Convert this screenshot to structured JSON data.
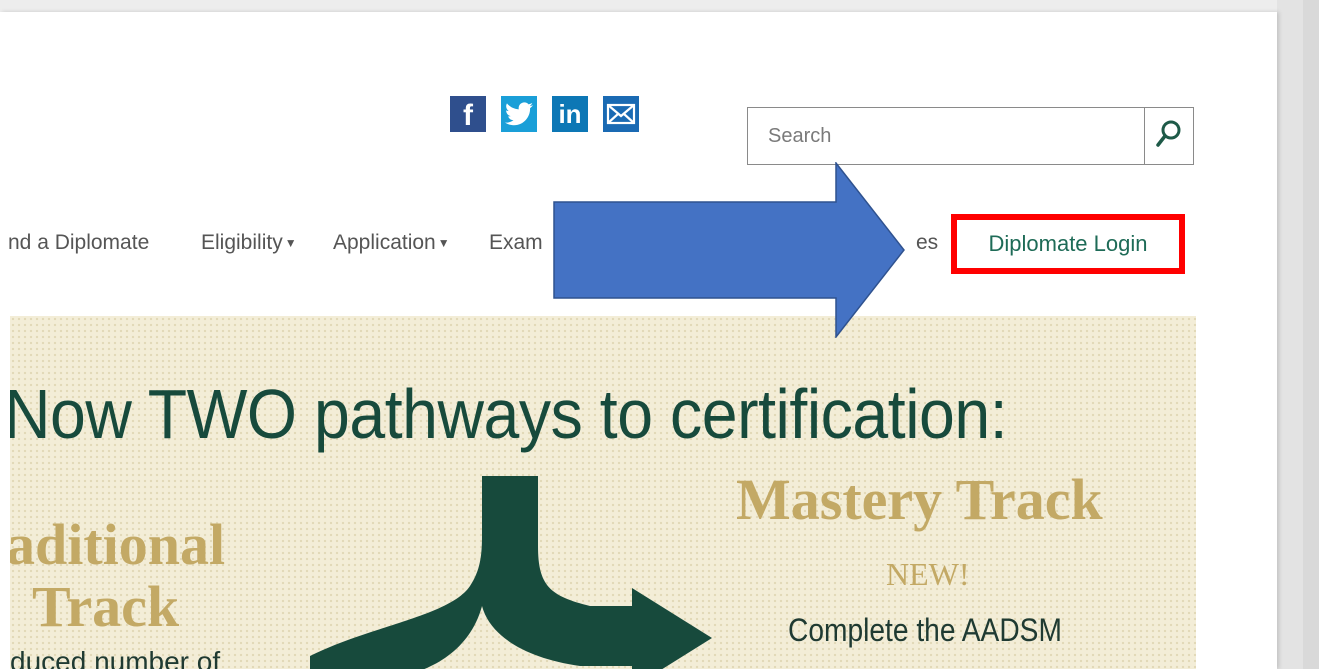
{
  "search": {
    "placeholder": "Search"
  },
  "social": {
    "facebook_glyph": "f",
    "linkedin_glyph": "in",
    "icons": [
      "facebook-icon",
      "twitter-icon",
      "linkedin-icon",
      "email-icon"
    ]
  },
  "nav": {
    "items": [
      {
        "label": "nd a Diplomate"
      },
      {
        "label": "Eligibility"
      },
      {
        "label": "Application"
      },
      {
        "label": "Exam"
      },
      {
        "label": "es"
      },
      {
        "label": "Diplomate Login"
      }
    ]
  },
  "banner": {
    "headline": "Now TWO pathways to certification:",
    "traditional_line1": "aditional",
    "traditional_line2": "Track",
    "traditional_desc": "duced number of",
    "mastery_title": "Mastery Track",
    "mastery_new": "NEW!",
    "mastery_desc": "Complete the AADSM"
  },
  "colors": {
    "accent_green": "#174a3c",
    "gold": "#c3a965",
    "highlight_red": "#ff0000",
    "annotation_blue": "#4472c4",
    "login_green": "#1e6b57"
  }
}
